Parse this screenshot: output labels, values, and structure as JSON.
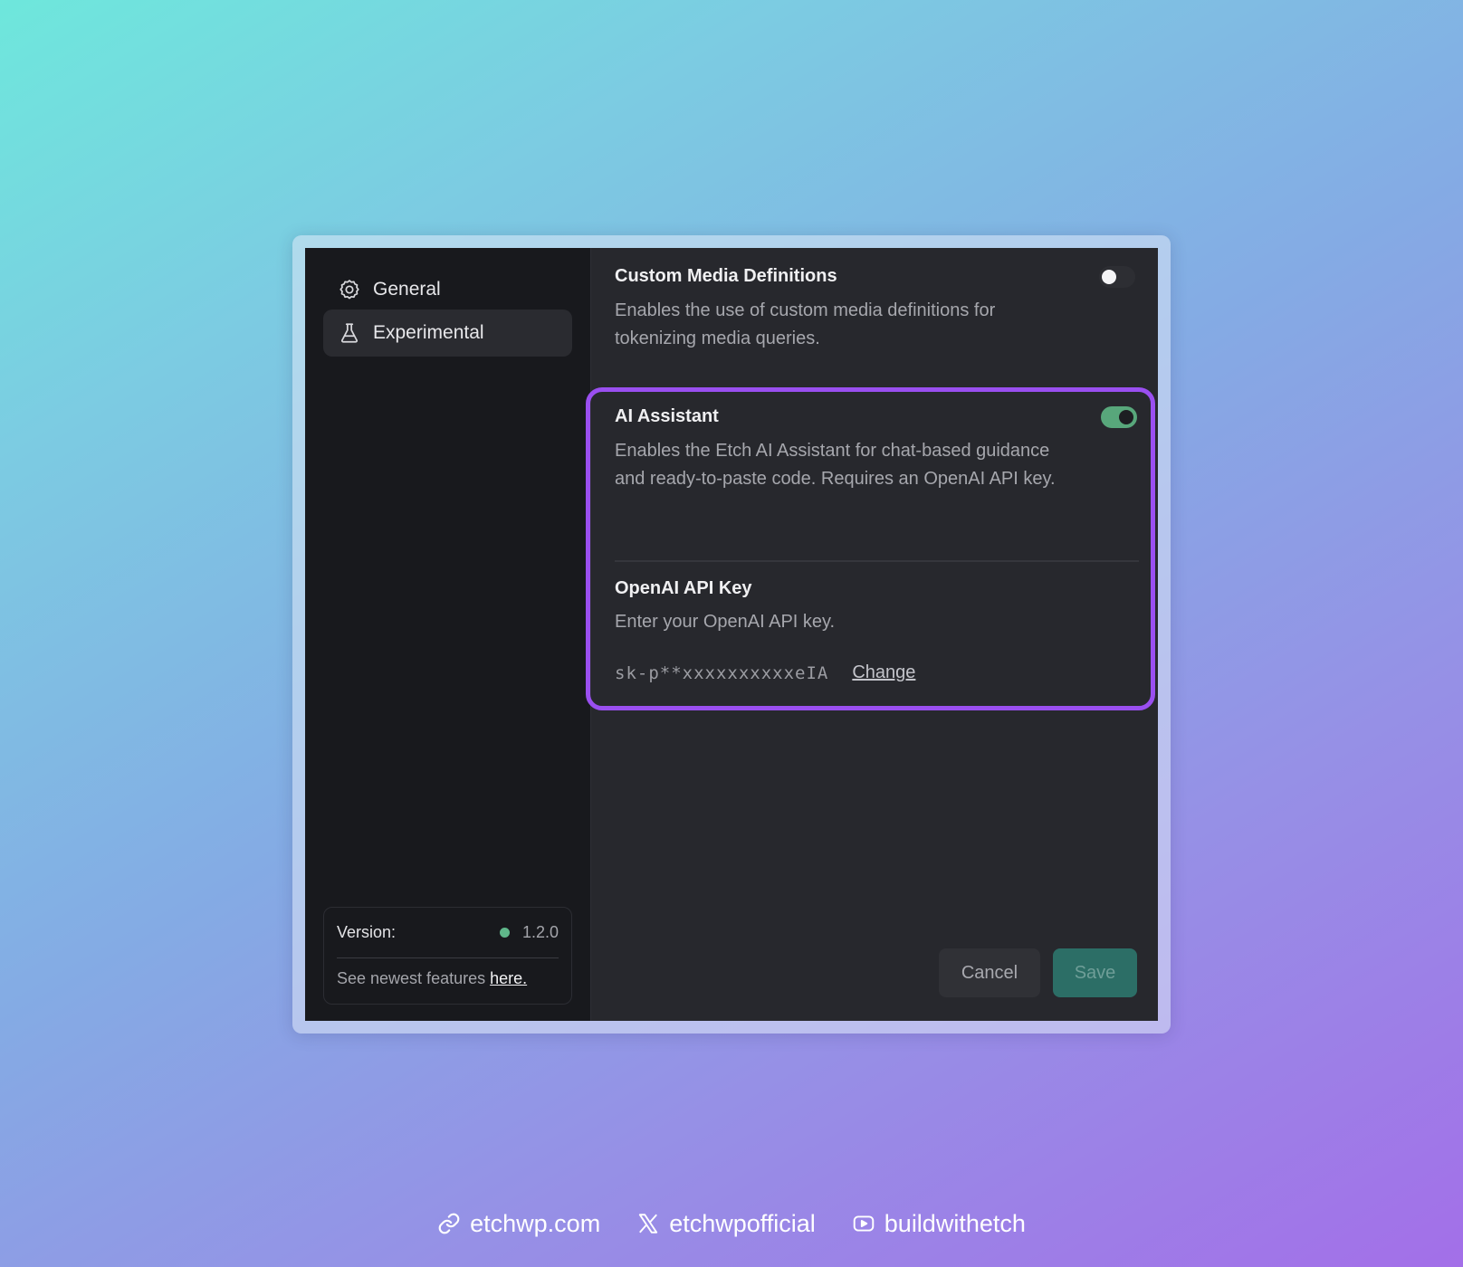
{
  "sidebar": {
    "items": [
      {
        "label": "General",
        "icon": "gear-icon",
        "active": false
      },
      {
        "label": "Experimental",
        "icon": "flask-icon",
        "active": true
      }
    ],
    "version": {
      "label": "Version:",
      "value": "1.2.0",
      "status_color": "#5fb78a",
      "newest_text": "See newest features",
      "newest_link": "here."
    }
  },
  "settings": {
    "custom_media": {
      "title": "Custom Media Definitions",
      "description": "Enables the use of custom media definitions for tokenizing media queries.",
      "enabled": false
    },
    "ai_assistant": {
      "title": "AI Assistant",
      "description": "Enables the Etch AI Assistant for chat-based guidance and ready-to-paste code. Requires an OpenAI API key.",
      "enabled": true
    },
    "openai_key": {
      "title": "OpenAI API Key",
      "description": "Enter your OpenAI API key.",
      "value": "sk-p**xxxxxxxxxxeIA",
      "change_label": "Change"
    }
  },
  "actions": {
    "cancel_label": "Cancel",
    "save_label": "Save"
  },
  "footer": {
    "links": [
      {
        "label": "etchwp.com",
        "icon": "link-icon"
      },
      {
        "label": "etchwpofficial",
        "icon": "x-logo-icon"
      },
      {
        "label": "buildwithetch",
        "icon": "youtube-icon"
      }
    ]
  },
  "colors": {
    "highlight": "#9a4ff0",
    "toggle_on": "#58a77b",
    "save_button": "#2c6e66"
  }
}
